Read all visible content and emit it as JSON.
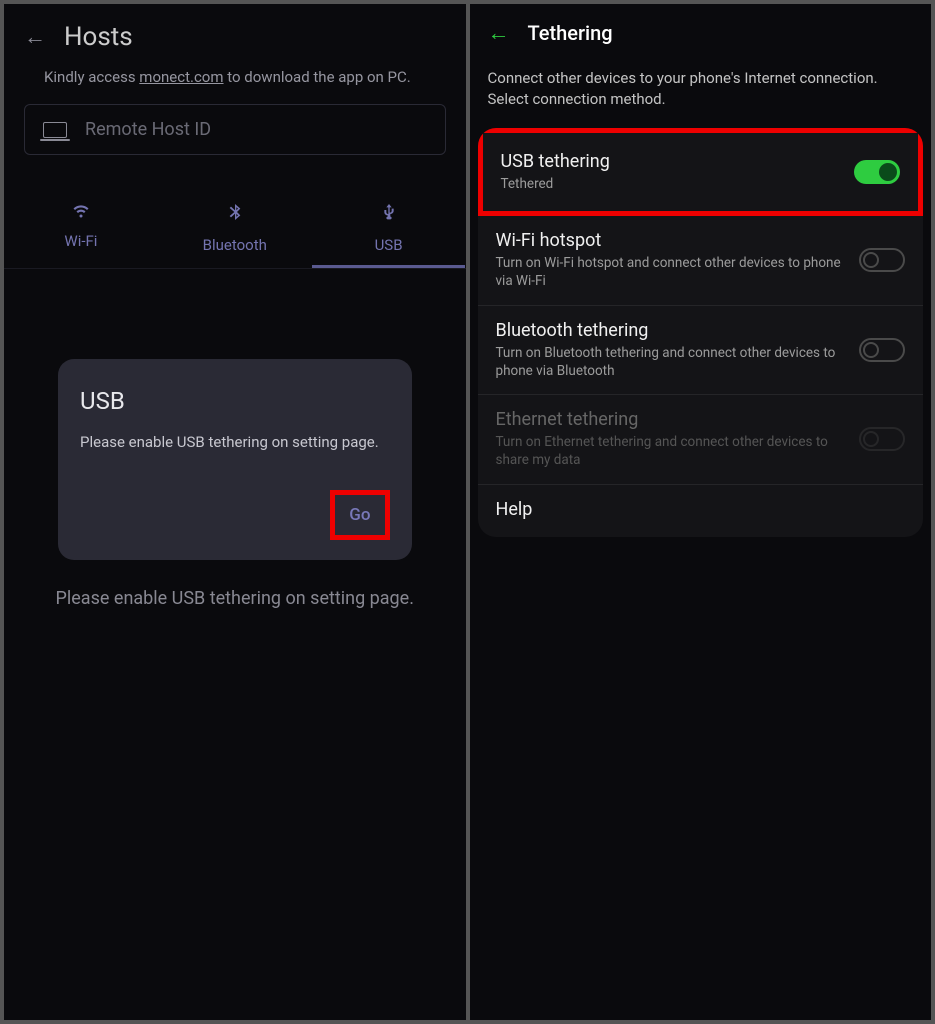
{
  "left": {
    "title": "Hosts",
    "subtitle_pre": "Kindly access ",
    "subtitle_link": "monect.com",
    "subtitle_post": " to download the app on PC.",
    "input_placeholder": "Remote Host ID",
    "tabs": [
      {
        "label": "Wi-Fi"
      },
      {
        "label": "Bluetooth"
      },
      {
        "label": "USB"
      }
    ],
    "dialog": {
      "title": "USB",
      "message": "Please enable USB tethering on setting page.",
      "action": "Go"
    },
    "hint": "Please enable USB tethering on setting page."
  },
  "right": {
    "title": "Tethering",
    "subtitle": "Connect other devices to your phone's Internet connection. Select connection method.",
    "rows": [
      {
        "title": "USB tethering",
        "desc": "Tethered",
        "toggle": "on",
        "highlighted": true
      },
      {
        "title": "Wi-Fi hotspot",
        "desc": "Turn on Wi-Fi hotspot and connect other devices to phone via Wi-Fi",
        "toggle": "off"
      },
      {
        "title": "Bluetooth tethering",
        "desc": "Turn on Bluetooth tethering and connect other devices to phone via Bluetooth",
        "toggle": "off"
      },
      {
        "title": "Ethernet tethering",
        "desc": "Turn on Ethernet tethering and connect other devices to share my data",
        "toggle": "disabled",
        "disabled": true
      },
      {
        "title": "Help"
      }
    ]
  }
}
